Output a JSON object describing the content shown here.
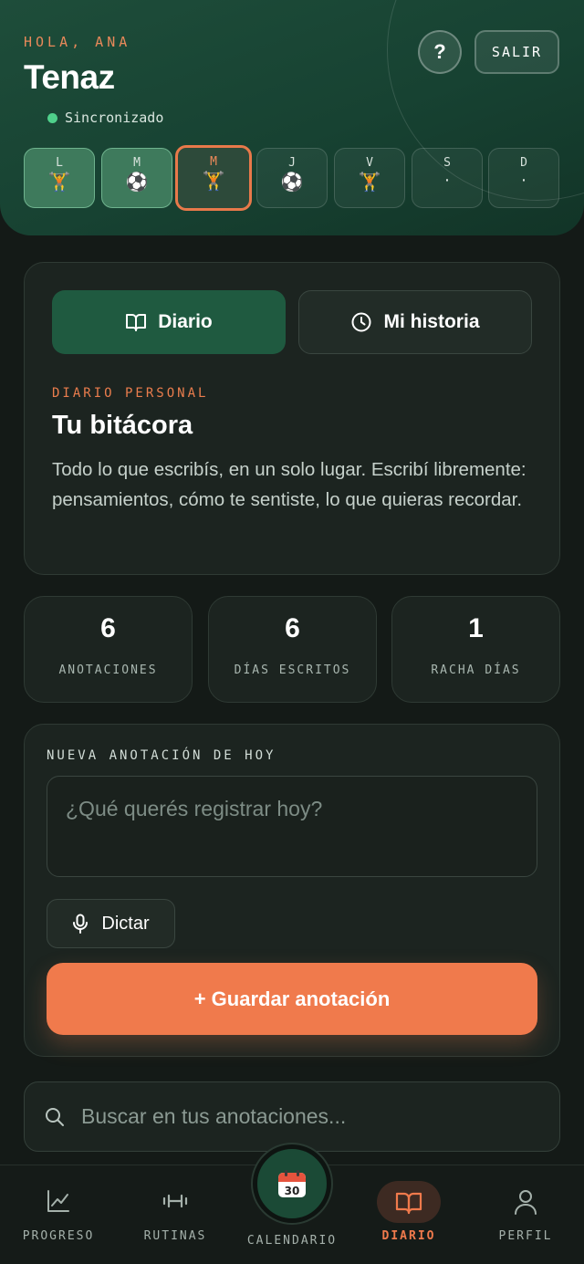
{
  "header": {
    "greeting": "HOLA, ANA",
    "brand": "Tenaz",
    "sync_status": "Sincronizado",
    "help_label": "?",
    "logout_label": "SALIR",
    "week": [
      {
        "letter": "L",
        "emoji": "🏋️",
        "state": "done"
      },
      {
        "letter": "M",
        "emoji": "⚽",
        "state": "done"
      },
      {
        "letter": "M",
        "emoji": "🏋️",
        "state": "today"
      },
      {
        "letter": "J",
        "emoji": "⚽",
        "state": "planned"
      },
      {
        "letter": "V",
        "emoji": "🏋️",
        "state": "planned"
      },
      {
        "letter": "S",
        "emoji": "·",
        "state": "empty"
      },
      {
        "letter": "D",
        "emoji": "·",
        "state": "empty"
      }
    ]
  },
  "tabs": {
    "diario": "Diario",
    "historia": "Mi historia"
  },
  "intro": {
    "kicker": "DIARIO PERSONAL",
    "title": "Tu bitácora",
    "description": "Todo lo que escribís, en un solo lugar. Escribí libremente: pensamientos, cómo te sentiste, lo que quieras recordar."
  },
  "stats": [
    {
      "value": "6",
      "label": "ANOTACIONES"
    },
    {
      "value": "6",
      "label": "DÍAS ESCRITOS"
    },
    {
      "value": "1",
      "label": "RACHA DÍAS"
    }
  ],
  "new_entry": {
    "label": "NUEVA ANOTACIÓN DE HOY",
    "placeholder": "¿Qué querés registrar hoy?",
    "dictate": "Dictar",
    "save": "+ Guardar anotación"
  },
  "search": {
    "placeholder": "Buscar en tus anotaciones..."
  },
  "nav": {
    "progreso": "PROGRESO",
    "rutinas": "RUTINAS",
    "calendario": "CALENDARIO",
    "calendar_day": "30",
    "diario": "DIARIO",
    "perfil": "PERFIL"
  },
  "colors": {
    "accent": "#f07a4c",
    "brand_green": "#1f5a40",
    "sync_dot": "#4fd08b"
  }
}
